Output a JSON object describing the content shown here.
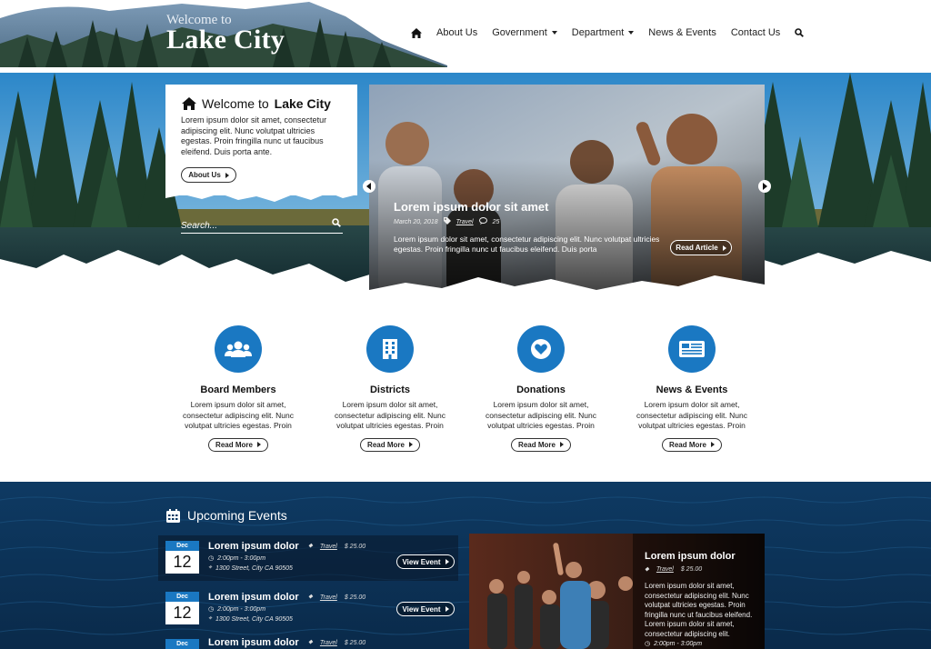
{
  "site": {
    "welcome": "Welcome to",
    "name": "Lake City"
  },
  "nav": {
    "items": [
      {
        "label": "About Us",
        "dropdown": false
      },
      {
        "label": "Government",
        "dropdown": true
      },
      {
        "label": "Department",
        "dropdown": true
      },
      {
        "label": "News & Events",
        "dropdown": false
      },
      {
        "label": "Contact Us",
        "dropdown": false
      }
    ]
  },
  "welcome_card": {
    "title_prefix": "Welcome to",
    "title_bold": "Lake City",
    "text": "Lorem ipsum dolor sit amet, consectetur adipiscing elit. Nunc volutpat ultricies egestas. Proin fringilla nunc ut faucibus eleifend. Duis porta ante.",
    "button": "About Us"
  },
  "search": {
    "placeholder": "Search..."
  },
  "slider": {
    "title": "Lorem ipsum dolor sit amet",
    "date": "March 20, 2018",
    "category": "Travel",
    "comments": "25",
    "text": "Lorem ipsum dolor sit amet, consectetur adipiscing elit. Nunc volutpat ultricies egestas. Proin fringilla nunc ut faucibus eleifend. Duis porta",
    "button": "Read Article"
  },
  "features": [
    {
      "title": "Board Members",
      "text": "Lorem ipsum dolor sit amet, consectetur adipiscing elit. Nunc volutpat ultricies egestas. Proin",
      "button": "Read More",
      "icon": "users-icon"
    },
    {
      "title": "Districts",
      "text": "Lorem ipsum dolor sit amet, consectetur adipiscing elit. Nunc volutpat ultricies egestas. Proin",
      "button": "Read More",
      "icon": "building-icon"
    },
    {
      "title": "Donations",
      "text": "Lorem ipsum dolor sit amet, consectetur adipiscing elit. Nunc volutpat ultricies egestas. Proin",
      "button": "Read More",
      "icon": "heart-icon"
    },
    {
      "title": "News & Events",
      "text": "Lorem ipsum dolor sit amet, consectetur adipiscing elit. Nunc volutpat ultricies egestas. Proin",
      "button": "Read More",
      "icon": "newspaper-icon"
    }
  ],
  "events": {
    "title": "Upcoming Events",
    "items": [
      {
        "month": "Dec",
        "day": "12",
        "title": "Lorem ipsum dolor",
        "category": "Travel",
        "price": "$ 25.00",
        "time": "2:00pm - 3:00pm",
        "address": "1300 Street, City CA 90505",
        "button": "View Event"
      },
      {
        "month": "Dec",
        "day": "12",
        "title": "Lorem ipsum dolor",
        "category": "Travel",
        "price": "$ 25.00",
        "time": "2:00pm - 3:00pm",
        "address": "1300 Street, City CA 90505",
        "button": "View Event"
      },
      {
        "month": "Dec",
        "day": "",
        "title": "Lorem ipsum dolor",
        "category": "Travel",
        "price": "$ 25.00",
        "time": "",
        "address": "",
        "button": ""
      }
    ],
    "featured": {
      "title": "Lorem ipsum dolor",
      "category": "Travel",
      "price": "$ 25.00",
      "text": "Lorem ipsum dolor sit amet, consectetur adipiscing elit. Nunc volutpat ultricies egestas. Proin fringilla nunc ut faucibus eleifend. Lorem ipsum dolor sit amet, consectetur adipiscing elit.",
      "time": "2:00pm - 3:00pm"
    }
  },
  "colors": {
    "accent": "#1a78c2",
    "header_bg": "#ffffff",
    "events_bg": "#123456"
  }
}
